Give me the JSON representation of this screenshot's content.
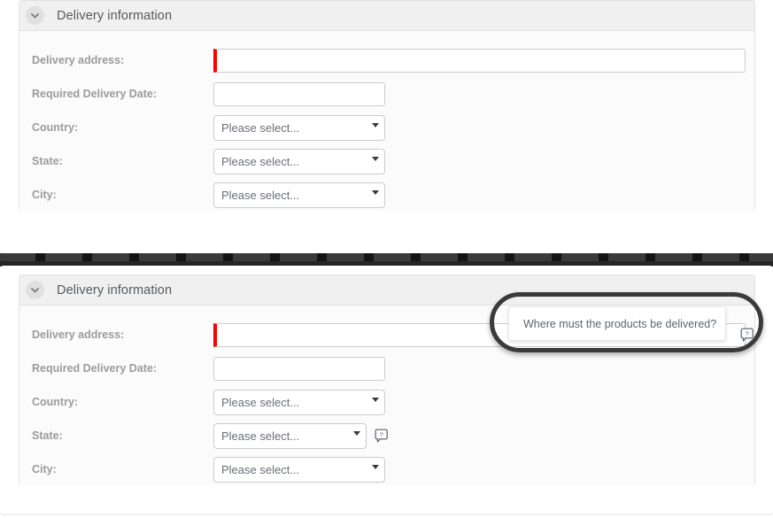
{
  "panels": [
    {
      "id": "top",
      "title": "Delivery information",
      "toggle_icon": "chevron-down-icon",
      "fields": {
        "address_label": "Delivery address:",
        "address_value": "",
        "address_placeholder": "",
        "date_label": "Required Delivery Date:",
        "date_value": "",
        "date_placeholder": "",
        "country_label": "Country:",
        "country_value": "Please select...",
        "state_label": "State:",
        "state_value": "Please select...",
        "city_label": "City:",
        "city_value": "Please select..."
      }
    },
    {
      "id": "bottom",
      "title": "Delivery information",
      "toggle_icon": "chevron-down-icon",
      "fields": {
        "address_label": "Delivery address:",
        "address_value": "",
        "address_placeholder": "",
        "date_label": "Required Delivery Date:",
        "date_value": "",
        "date_placeholder": "",
        "country_label": "Country:",
        "country_value": "Please select...",
        "state_label": "State:",
        "state_value": "Please select...",
        "city_label": "City:",
        "city_value": "Please select..."
      },
      "help_icon": "help-speech-bubble-icon"
    }
  ],
  "tooltip": {
    "text": "Where must the products be delivered?",
    "icon": "help-speech-bubble-icon"
  },
  "separator": {
    "icon": "perforated-strip-divider"
  },
  "colors": {
    "required_marker": "#ff0000",
    "panel_header": "#f0f0f0",
    "panel_body": "#fbfbfb",
    "border": "#cccccc",
    "label_text": "#9b9b9b",
    "title_text": "#555a5e",
    "select_text": "#6b6f77",
    "annotation_ring": "#3a3a3a",
    "separator": "#1f1f1f"
  }
}
